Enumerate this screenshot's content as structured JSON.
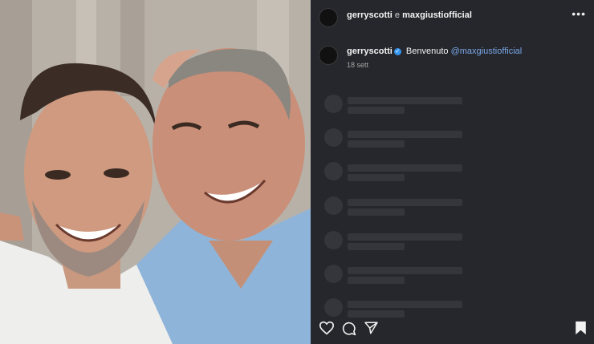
{
  "header": {
    "author": "gerryscotti",
    "connector": "e",
    "collaborator": "maxgiustiofficial",
    "more_icon": "more-horizontal-icon"
  },
  "caption": {
    "username": "gerryscotti",
    "verified_icon": "verified-badge-icon",
    "text": "Benvenuto",
    "mention": "@maxgiustiofficial",
    "time": "18 sett"
  },
  "comments_loading": {
    "placeholder_rows": 7
  },
  "actions": {
    "like_icon": "heart-icon",
    "comment_icon": "comment-icon",
    "share_icon": "send-icon",
    "save_icon": "bookmark-icon"
  },
  "colors": {
    "panel_bg": "#25272c",
    "skeleton": "#34363b",
    "mention": "#7aa7e8",
    "verified": "#3897f0"
  }
}
